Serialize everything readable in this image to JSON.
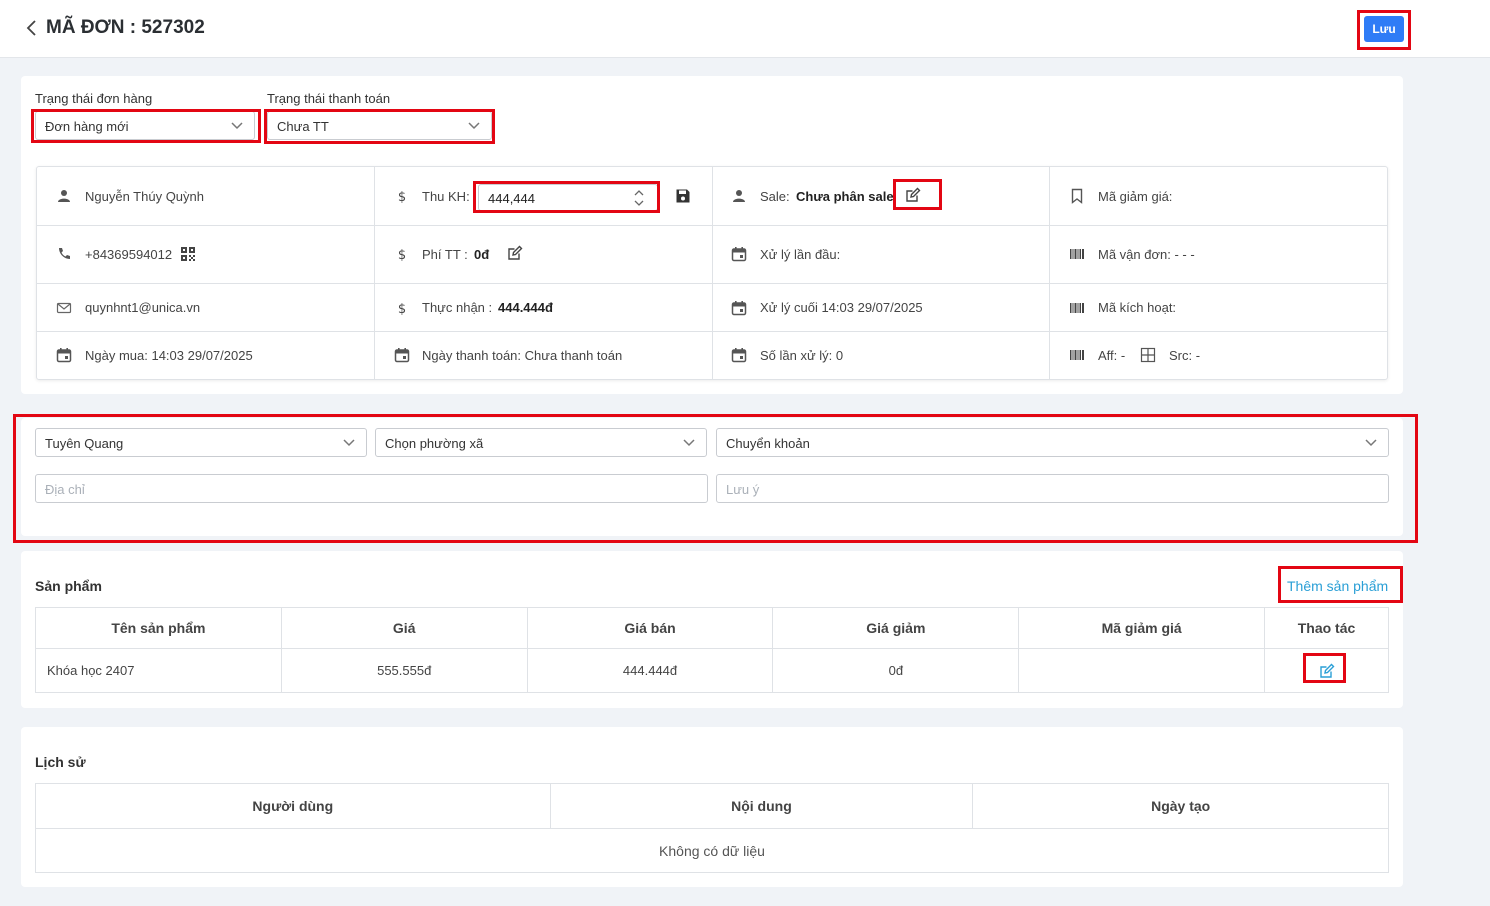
{
  "header": {
    "title": "MÃ ĐƠN : 527302",
    "save_label": "Lưu"
  },
  "status": {
    "order_status_label": "Trạng thái đơn hàng",
    "order_status_value": "Đơn hàng mới",
    "payment_status_label": "Trạng thái thanh toán",
    "payment_status_value": "Chưa TT"
  },
  "info": {
    "customer_name": "Nguyễn Thúy Quỳnh",
    "phone": "+84369594012",
    "email": "quynhnt1@unica.vn",
    "purchase_date": "Ngày mua: 14:03 29/07/2025",
    "thu_kh_label": "Thu KH:",
    "thu_kh_value": "444,444",
    "phi_tt_label": "Phí TT :",
    "phi_tt_value": "0đ",
    "thuc_nhan_label": "Thực nhận :",
    "thuc_nhan_value": "444.444đ",
    "payment_date": "Ngày thanh toán: Chưa thanh toán",
    "sale_label": "Sale:",
    "sale_value": "Chưa phân sale",
    "first_process": "Xử lý lần đầu:",
    "last_process": "Xử lý cuối 14:03 29/07/2025",
    "process_count": "Số lần xử lý: 0",
    "discount_code": "Mã giảm giá:",
    "tracking_code": "Mã vận đơn: - - -",
    "activation_code": "Mã kích hoạt:",
    "aff": "Aff: -",
    "src": "Src: -"
  },
  "address": {
    "province": "Tuyên Quang",
    "ward_placeholder": "Chọn phường xã",
    "payment_method": "Chuyển khoản",
    "address_placeholder": "Địa chỉ",
    "note_placeholder": "Lưu ý"
  },
  "products": {
    "title": "Sản phẩm",
    "add_label": "Thêm sản phẩm",
    "columns": [
      "Tên sản phẩm",
      "Giá",
      "Giá bán",
      "Giá giảm",
      "Mã giảm giá",
      "Thao tác"
    ],
    "rows": [
      {
        "name": "Khóa học 2407",
        "price": "555.555đ",
        "sale_price": "444.444đ",
        "discount": "0đ",
        "code": ""
      }
    ]
  },
  "history": {
    "title": "Lịch sử",
    "columns": [
      "Người dùng",
      "Nội dung",
      "Ngày tạo"
    ],
    "empty": "Không có dữ liệu"
  },
  "icons": [
    "chevron-left-icon",
    "user-icon",
    "dollar-icon",
    "save-icon",
    "edit-icon",
    "bookmark-icon",
    "phone-icon",
    "qr-icon",
    "calendar-icon",
    "barcode-icon",
    "mail-icon",
    "grid-icon",
    "chevron-down-icon"
  ],
  "colors": {
    "primary": "#2f7cf6",
    "link": "#2a9fd6",
    "highlight": "#e30613"
  }
}
